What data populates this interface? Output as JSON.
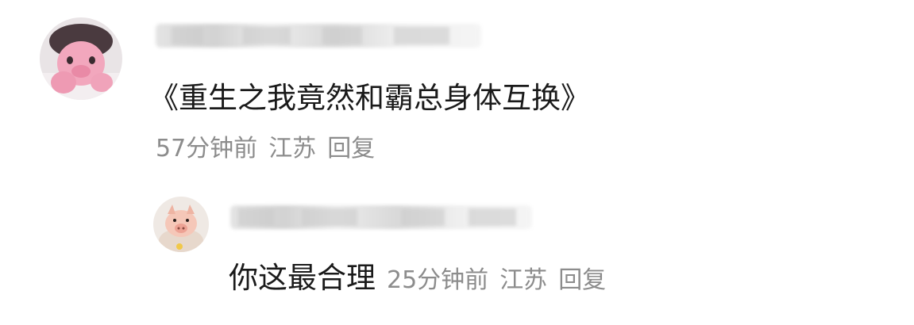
{
  "comment": {
    "text": "《重生之我竟然和霸总身体互换》",
    "time": "57分钟前",
    "location": "江苏",
    "reply_label": "回复",
    "avatar_icon": "pink-cartoon-avatar-icon"
  },
  "reply": {
    "text": "你这最合理",
    "time": "25分钟前",
    "location": "江苏",
    "reply_label": "回复",
    "avatar_icon": "pig-avatar-icon"
  },
  "colors": {
    "text": "#1a1a1a",
    "meta": "#8c8c8c",
    "background": "#ffffff"
  }
}
